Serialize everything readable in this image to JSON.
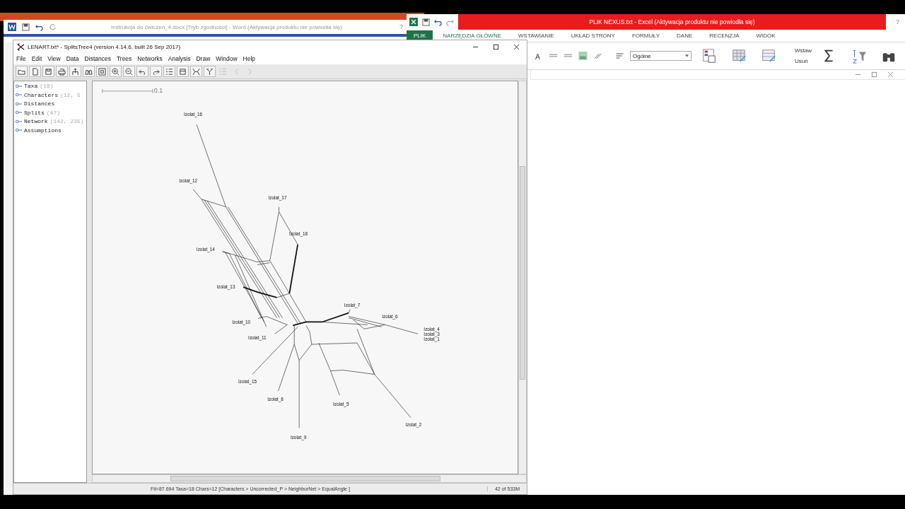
{
  "word_window": {
    "title": "Instrukcja do ćwiczeń_4.docx [Tryb zgodności] - Word (Aktywacja produktu nie powiodła się)",
    "help": "?"
  },
  "excel_window": {
    "title": "PLIK NEXUS.txt -  Excel (Aktywacja produktu nie powiodła się)",
    "help": "?",
    "tabs": [
      {
        "label": "PLIK",
        "selected": true
      },
      {
        "label": "NARZĘDZIA GŁÓWNE",
        "selected": false
      },
      {
        "label": "WSTAWIANIE",
        "selected": false
      },
      {
        "label": "UKŁAD STRONY",
        "selected": false
      },
      {
        "label": "FORMUŁY",
        "selected": false
      },
      {
        "label": "DANE",
        "selected": false
      },
      {
        "label": "RECENZJA",
        "selected": false
      },
      {
        "label": "WIDOK",
        "selected": false
      }
    ],
    "number_format": "Ogólne",
    "insert_label": "Wstaw",
    "delete_label": "Usuń"
  },
  "splitstree": {
    "title": "LENART.txt* - SplitsTree4 (version 4.14.6, built 26 Sep 2017)",
    "menu": [
      "File",
      "Edit",
      "View",
      "Data",
      "Distances",
      "Trees",
      "Networks",
      "Analysis",
      "Draw",
      "Window",
      "Help"
    ],
    "toolbar": [
      {
        "kind": "open",
        "disabled": false
      },
      {
        "kind": "new",
        "disabled": false
      },
      {
        "kind": "save",
        "disabled": false
      },
      {
        "kind": "print",
        "disabled": false
      },
      {
        "kind": "export",
        "disabled": false
      },
      {
        "kind": "find",
        "disabled": false
      },
      {
        "kind": "fit",
        "disabled": false
      },
      {
        "kind": "zoom-in",
        "disabled": false
      },
      {
        "kind": "zoom-out",
        "disabled": false
      },
      {
        "kind": "undo",
        "disabled": false
      },
      {
        "kind": "redo",
        "disabled": false
      },
      {
        "kind": "list",
        "disabled": false
      },
      {
        "kind": "block",
        "disabled": false
      },
      {
        "kind": "cross",
        "disabled": false
      },
      {
        "kind": "tree",
        "disabled": false
      },
      {
        "kind": "list",
        "disabled": true
      },
      {
        "kind": "back",
        "disabled": true
      },
      {
        "kind": "forward",
        "disabled": true
      }
    ],
    "tree": [
      {
        "label": "Taxa",
        "count": "(18)"
      },
      {
        "label": "Characters",
        "count": "(12, 5"
      },
      {
        "label": "Distances"
      },
      {
        "label": "Splits",
        "count": "(47)"
      },
      {
        "label": "Network",
        "count": "(142, 235)"
      },
      {
        "label": "Assumptions"
      }
    ],
    "scale_label": "0.1",
    "taxa": [
      "Izolat_16",
      "Izolat_12",
      "Izolat_17",
      "Izolat_18",
      "Izolat_14",
      "Izolat_13",
      "Izolat_7",
      "Izolat_6",
      "Izolat_4",
      "Izolat_3",
      "Izolat_1",
      "Izolat_10",
      "Izolat_11",
      "Izolat_15",
      "Izolat_8",
      "Izolat_5",
      "Izolat_2",
      "Izolat_9"
    ],
    "status": "Fit=87.694 Taxa=18 Chars=12 [Characters > Uncorrected_P > NeighborNet > EqualAngle ]",
    "memory": "42 of 533M"
  }
}
